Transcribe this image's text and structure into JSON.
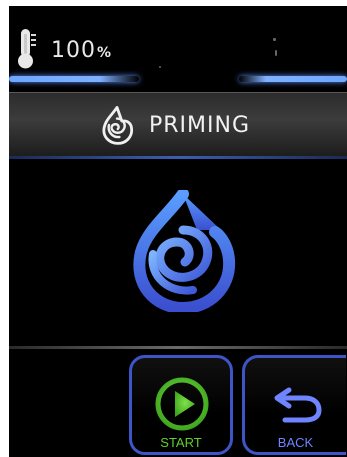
{
  "status": {
    "battery_value": "100",
    "battery_unit": "%",
    "icons": [
      "thermometer-icon"
    ]
  },
  "header": {
    "title": "PRIMING",
    "icon": "priming-drop-icon"
  },
  "main": {
    "icon": "priming-drop-icon"
  },
  "buttons": {
    "start_label": "START",
    "back_label": "BACK",
    "start_icon": "play-icon",
    "back_icon": "back-arrow-icon"
  },
  "colors": {
    "background": "#000000",
    "accent_blue": "#3e55c7",
    "start_green": "#5fd02b",
    "back_blue": "#6f84ff"
  }
}
